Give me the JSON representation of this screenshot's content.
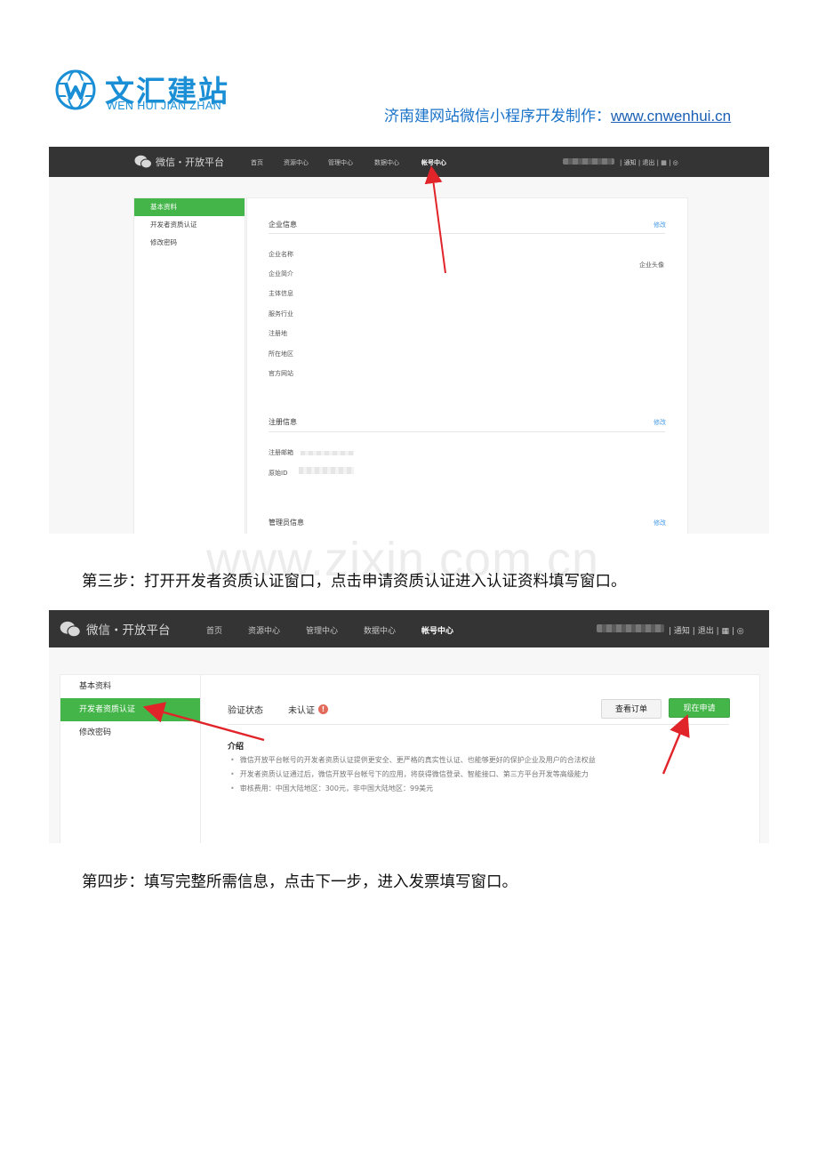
{
  "header": {
    "logo_cn": "文汇建站",
    "logo_en": "WEN HUI JIAN ZHAN",
    "tagline": "济南建网站微信小程序开发制作：",
    "url": "www.cnwenhui.cn"
  },
  "nav": {
    "brand": "微信・开放平台",
    "items": [
      "首页",
      "资源中心",
      "管理中心",
      "数据中心",
      "帐号中心"
    ],
    "active_index": 4,
    "right": {
      "notify": "通知",
      "logout": "退出"
    }
  },
  "screen1": {
    "sidebar": [
      "基本资料",
      "开发者资质认证",
      "修改密码"
    ],
    "active_index": 0,
    "enterprise": {
      "title": "企业信息",
      "edit": "修改",
      "avatar_label": "企业头像",
      "fields": [
        "企业名称",
        "企业简介",
        "主体信息",
        "服务行业",
        "注册地",
        "所在地区",
        "官方网站"
      ]
    },
    "registration": {
      "title": "注册信息",
      "edit": "修改",
      "fields": [
        "注册邮箱",
        "原始ID"
      ]
    },
    "admin": {
      "title": "管理员信息",
      "edit": "修改"
    }
  },
  "watermark": "www.zixin.com.cn",
  "caption1": "第三步：打开开发者资质认证窗口，点击申请资质认证进入认证资料填写窗口。",
  "screen2": {
    "sidebar": [
      "基本资料",
      "开发者资质认证",
      "修改密码"
    ],
    "active_index": 1,
    "status_label": "验证状态",
    "status_value": "未认证",
    "btn_orders": "查看订单",
    "btn_apply": "现在申请",
    "intro_title": "介绍",
    "bullets": [
      "微信开放平台帐号的开发者资质认证提供更安全、更严格的真实性认证、也能够更好的保护企业及用户的合法权益",
      "开发者资质认证通过后，微信开放平台帐号下的应用，将获得微信登录、智能接口、第三方平台开发等高级能力",
      "审核费用：中国大陆地区：300元，非中国大陆地区：99美元"
    ]
  },
  "caption2": "第四步：填写完整所需信息，点击下一步，进入发票填写窗口。",
  "colors": {
    "brand_blue": "#1a8fd6",
    "wechat_green": "#44b549",
    "nav_dark": "#343434",
    "arrow_red": "#e0242a"
  }
}
